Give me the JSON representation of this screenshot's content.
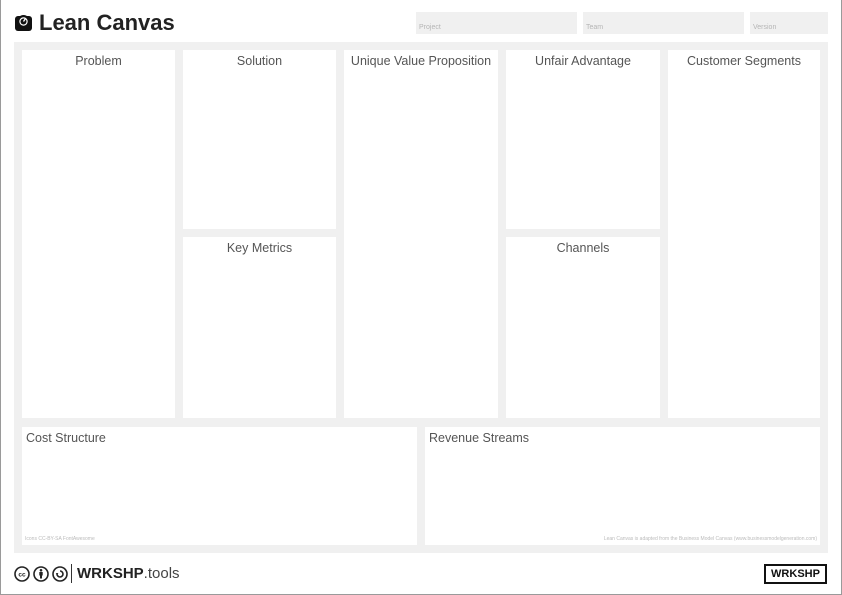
{
  "header": {
    "title": "Lean Canvas",
    "logo_icon": "dashboard-icon",
    "fields": [
      {
        "label": "Project",
        "value": ""
      },
      {
        "label": "Team",
        "value": ""
      },
      {
        "label": "Version",
        "value": ""
      }
    ]
  },
  "canvas": {
    "problem": "Problem",
    "solution": "Solution",
    "key_metrics": "Key Metrics",
    "unique_value_proposition": "Unique Value Proposition",
    "unfair_advantage": "Unfair Advantage",
    "channels": "Channels",
    "customer_segments": "Customer Segments",
    "cost_structure": "Cost Structure",
    "revenue_streams": "Revenue Streams",
    "icons_credit": "Icons CC-BY-SA FontAwesome",
    "adaptation_note": "Lean Canvas is adapted from the Business Model Canvas (www.businessmodelgeneration.com)"
  },
  "footer": {
    "license_icons": [
      "creative-commons-icon",
      "attribution-icon",
      "share-alike-icon"
    ],
    "brand_bold": "WRKSHP",
    "brand_suffix": ".tools",
    "badge": "WRKSHP"
  }
}
